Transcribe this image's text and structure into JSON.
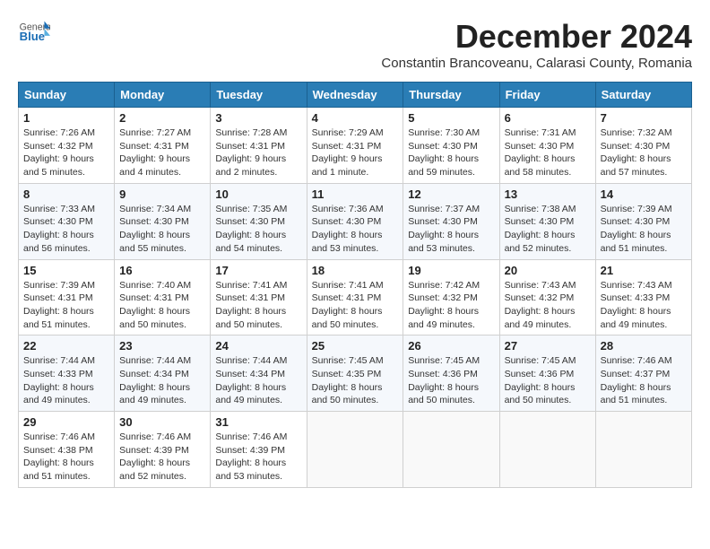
{
  "header": {
    "logo_general": "General",
    "logo_blue": "Blue",
    "month_title": "December 2024",
    "location": "Constantin Brancoveanu, Calarasi County, Romania"
  },
  "weekdays": [
    "Sunday",
    "Monday",
    "Tuesday",
    "Wednesday",
    "Thursday",
    "Friday",
    "Saturday"
  ],
  "weeks": [
    [
      {
        "day": "1",
        "info": "Sunrise: 7:26 AM\nSunset: 4:32 PM\nDaylight: 9 hours and 5 minutes."
      },
      {
        "day": "2",
        "info": "Sunrise: 7:27 AM\nSunset: 4:31 PM\nDaylight: 9 hours and 4 minutes."
      },
      {
        "day": "3",
        "info": "Sunrise: 7:28 AM\nSunset: 4:31 PM\nDaylight: 9 hours and 2 minutes."
      },
      {
        "day": "4",
        "info": "Sunrise: 7:29 AM\nSunset: 4:31 PM\nDaylight: 9 hours and 1 minute."
      },
      {
        "day": "5",
        "info": "Sunrise: 7:30 AM\nSunset: 4:30 PM\nDaylight: 8 hours and 59 minutes."
      },
      {
        "day": "6",
        "info": "Sunrise: 7:31 AM\nSunset: 4:30 PM\nDaylight: 8 hours and 58 minutes."
      },
      {
        "day": "7",
        "info": "Sunrise: 7:32 AM\nSunset: 4:30 PM\nDaylight: 8 hours and 57 minutes."
      }
    ],
    [
      {
        "day": "8",
        "info": "Sunrise: 7:33 AM\nSunset: 4:30 PM\nDaylight: 8 hours and 56 minutes."
      },
      {
        "day": "9",
        "info": "Sunrise: 7:34 AM\nSunset: 4:30 PM\nDaylight: 8 hours and 55 minutes."
      },
      {
        "day": "10",
        "info": "Sunrise: 7:35 AM\nSunset: 4:30 PM\nDaylight: 8 hours and 54 minutes."
      },
      {
        "day": "11",
        "info": "Sunrise: 7:36 AM\nSunset: 4:30 PM\nDaylight: 8 hours and 53 minutes."
      },
      {
        "day": "12",
        "info": "Sunrise: 7:37 AM\nSunset: 4:30 PM\nDaylight: 8 hours and 53 minutes."
      },
      {
        "day": "13",
        "info": "Sunrise: 7:38 AM\nSunset: 4:30 PM\nDaylight: 8 hours and 52 minutes."
      },
      {
        "day": "14",
        "info": "Sunrise: 7:39 AM\nSunset: 4:30 PM\nDaylight: 8 hours and 51 minutes."
      }
    ],
    [
      {
        "day": "15",
        "info": "Sunrise: 7:39 AM\nSunset: 4:31 PM\nDaylight: 8 hours and 51 minutes."
      },
      {
        "day": "16",
        "info": "Sunrise: 7:40 AM\nSunset: 4:31 PM\nDaylight: 8 hours and 50 minutes."
      },
      {
        "day": "17",
        "info": "Sunrise: 7:41 AM\nSunset: 4:31 PM\nDaylight: 8 hours and 50 minutes."
      },
      {
        "day": "18",
        "info": "Sunrise: 7:41 AM\nSunset: 4:31 PM\nDaylight: 8 hours and 50 minutes."
      },
      {
        "day": "19",
        "info": "Sunrise: 7:42 AM\nSunset: 4:32 PM\nDaylight: 8 hours and 49 minutes."
      },
      {
        "day": "20",
        "info": "Sunrise: 7:43 AM\nSunset: 4:32 PM\nDaylight: 8 hours and 49 minutes."
      },
      {
        "day": "21",
        "info": "Sunrise: 7:43 AM\nSunset: 4:33 PM\nDaylight: 8 hours and 49 minutes."
      }
    ],
    [
      {
        "day": "22",
        "info": "Sunrise: 7:44 AM\nSunset: 4:33 PM\nDaylight: 8 hours and 49 minutes."
      },
      {
        "day": "23",
        "info": "Sunrise: 7:44 AM\nSunset: 4:34 PM\nDaylight: 8 hours and 49 minutes."
      },
      {
        "day": "24",
        "info": "Sunrise: 7:44 AM\nSunset: 4:34 PM\nDaylight: 8 hours and 49 minutes."
      },
      {
        "day": "25",
        "info": "Sunrise: 7:45 AM\nSunset: 4:35 PM\nDaylight: 8 hours and 50 minutes."
      },
      {
        "day": "26",
        "info": "Sunrise: 7:45 AM\nSunset: 4:36 PM\nDaylight: 8 hours and 50 minutes."
      },
      {
        "day": "27",
        "info": "Sunrise: 7:45 AM\nSunset: 4:36 PM\nDaylight: 8 hours and 50 minutes."
      },
      {
        "day": "28",
        "info": "Sunrise: 7:46 AM\nSunset: 4:37 PM\nDaylight: 8 hours and 51 minutes."
      }
    ],
    [
      {
        "day": "29",
        "info": "Sunrise: 7:46 AM\nSunset: 4:38 PM\nDaylight: 8 hours and 51 minutes."
      },
      {
        "day": "30",
        "info": "Sunrise: 7:46 AM\nSunset: 4:39 PM\nDaylight: 8 hours and 52 minutes."
      },
      {
        "day": "31",
        "info": "Sunrise: 7:46 AM\nSunset: 4:39 PM\nDaylight: 8 hours and 53 minutes."
      },
      null,
      null,
      null,
      null
    ]
  ]
}
